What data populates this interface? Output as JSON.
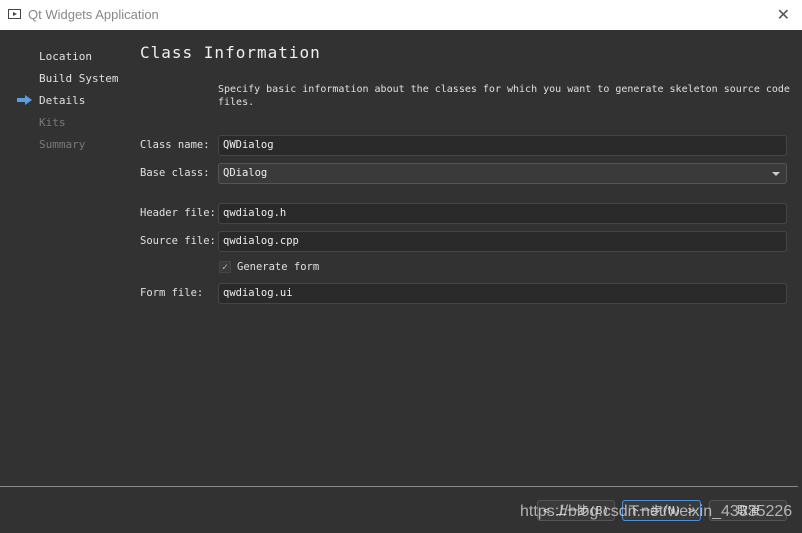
{
  "window": {
    "title": "Qt Widgets Application",
    "close_icon": "close-icon"
  },
  "sidebar": {
    "items": [
      {
        "label": "Location",
        "state": "done"
      },
      {
        "label": "Build System",
        "state": "done"
      },
      {
        "label": "Details",
        "state": "current"
      },
      {
        "label": "Kits",
        "state": "disabled"
      },
      {
        "label": "Summary",
        "state": "disabled"
      }
    ],
    "current_icon": "arrow-right-icon",
    "accent": "#4a90d9"
  },
  "page": {
    "title": "Class Information",
    "description": "Specify basic information about the classes for which you want to generate skeleton source code files.",
    "fields": {
      "class_name": {
        "label": "Class name:",
        "value": "QWDialog"
      },
      "base_class": {
        "label": "Base class:",
        "value": "QDialog"
      },
      "header_file": {
        "label": "Header file:",
        "value": "qwdialog.h"
      },
      "source_file": {
        "label": "Source file:",
        "value": "qwdialog.cpp"
      },
      "generate_form": {
        "label": "Generate form",
        "checked": true,
        "check": "✓"
      },
      "form_file": {
        "label": "Form file:",
        "value": "qwdialog.ui"
      }
    }
  },
  "footer": {
    "back": "< 上一步(B)",
    "next": "下一步(N) >",
    "cancel": "取消"
  },
  "watermark": "https://blog.csdn.net/weixin_43335226"
}
